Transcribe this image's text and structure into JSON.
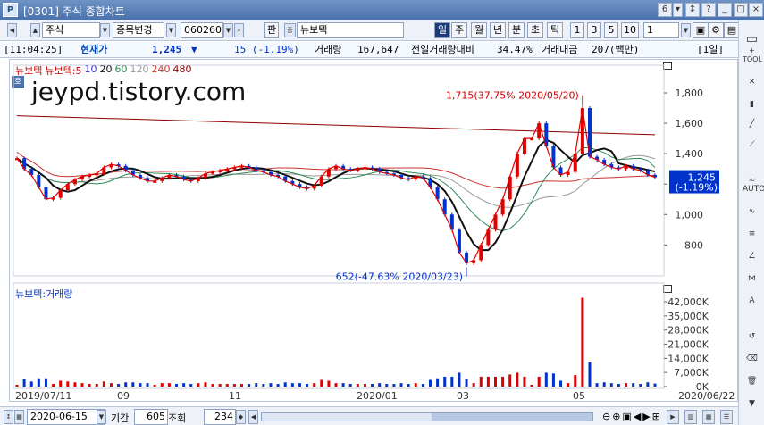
{
  "window": {
    "title": "[0301] 주식 종합차트",
    "logo": "P",
    "screen_num": "6",
    "buttons": [
      "▾",
      "↕",
      "?",
      "_",
      "□",
      "×"
    ]
  },
  "toolbar": {
    "market": "주식",
    "search_mode": "종목변경",
    "code": "060260",
    "pan_label": "판",
    "company": "뉴보텍",
    "periods": [
      "일",
      "주",
      "월",
      "년",
      "분",
      "초",
      "틱"
    ],
    "selected_period": "일",
    "intervals": [
      "1",
      "3",
      "5",
      "10"
    ],
    "interval_value": "1"
  },
  "info": {
    "time": "[11:04:25]",
    "price_label": "현재가",
    "price": "1,245",
    "arrow": "▼",
    "change": "15 (-1.19%)",
    "vol_label": "거래량",
    "volume": "167,647",
    "ratio_label": "전일거래량대비",
    "ratio": "34.47%",
    "amount_label": "거래대금",
    "amount": "207(백만)",
    "period_label": "[1일]"
  },
  "watermark": "jeypd.tistory.com",
  "legend_price": {
    "name": "뉴보텍",
    "ma_label": "뉴보텍:5",
    "mas": [
      {
        "n": "10",
        "color": "#3333cc"
      },
      {
        "n": "20",
        "color": "#111111"
      },
      {
        "n": "60",
        "color": "#2e8b57"
      },
      {
        "n": "120",
        "color": "#999999"
      },
      {
        "n": "240",
        "color": "#cc3333"
      },
      {
        "n": "480",
        "color": "#8b0000"
      }
    ],
    "marker": "호"
  },
  "legend_volume": {
    "name": "뉴보텍:거래량"
  },
  "chart_data": [
    {
      "type": "line",
      "title": "뉴보텍",
      "y_ticks": [
        "1,800",
        "1,600",
        "1,400",
        "1,200",
        "1,000",
        "800"
      ],
      "ylim": [
        620,
        1900
      ],
      "x_labels": [
        "2019/07/11",
        "09",
        "11",
        "2020/01",
        "03",
        "05",
        "2020/06/22"
      ],
      "annotations": [
        {
          "text": "1,715(37.75% 2020/05/20)",
          "value": 1715
        },
        {
          "text": "652(-47.63% 2020/03/23)",
          "value": 652
        }
      ],
      "current": {
        "price": "1,245",
        "change": "(-1.19%)"
      },
      "series": [
        {
          "name": "뉴보텍",
          "values": [
            1370,
            1300,
            1260,
            1180,
            1100,
            1110,
            1160,
            1200,
            1230,
            1250,
            1260,
            1270,
            1310,
            1330,
            1320,
            1290,
            1260,
            1240,
            1220,
            1220,
            1240,
            1260,
            1250,
            1230,
            1220,
            1240,
            1270,
            1280,
            1290,
            1300,
            1310,
            1320,
            1310,
            1290,
            1280,
            1260,
            1250,
            1220,
            1200,
            1180,
            1170,
            1190,
            1250,
            1300,
            1320,
            1300,
            1290,
            1300,
            1310,
            1300,
            1280,
            1270,
            1260,
            1240,
            1230,
            1250,
            1240,
            1180,
            1100,
            1000,
            900,
            750,
            680,
            700,
            800,
            900,
            1000,
            1100,
            1250,
            1400,
            1500,
            1500,
            1600,
            1450,
            1310,
            1260,
            1280,
            1400,
            1700,
            1380,
            1360,
            1330,
            1310,
            1300,
            1320,
            1300,
            1290,
            1260,
            1245
          ]
        }
      ]
    },
    {
      "type": "bar",
      "title": "뉴보텍:거래량",
      "y_ticks": [
        "42,000K",
        "35,000K",
        "28,000K",
        "21,000K",
        "14,000K",
        "7,000K",
        "0K"
      ],
      "ylim": [
        0,
        46000
      ]
    }
  ],
  "bottom": {
    "start_date": "2020-06-15",
    "period_label": "기간",
    "period_value": "605",
    "view_label": "조회",
    "view_value": "234"
  },
  "rightpanel": {
    "items": [
      "TOOL",
      "AUTO"
    ]
  }
}
